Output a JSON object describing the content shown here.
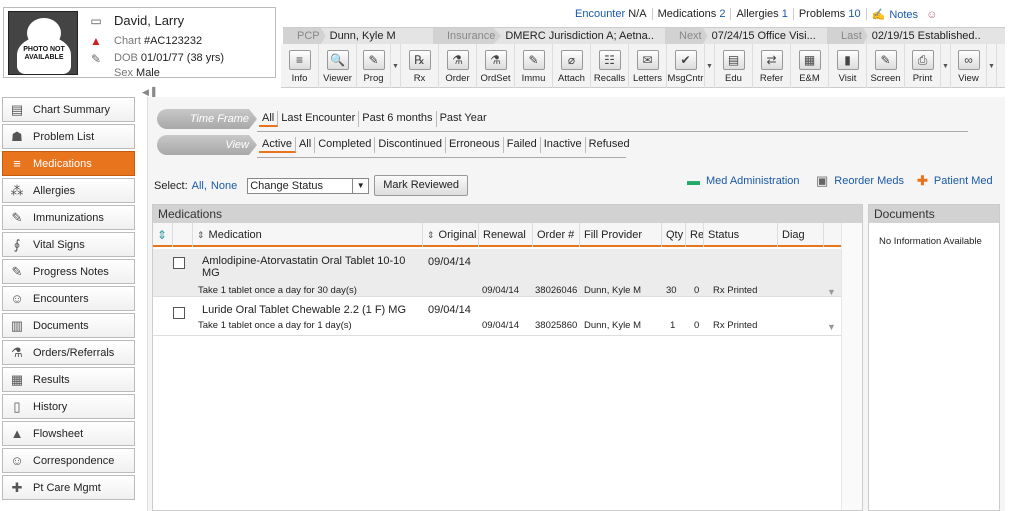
{
  "patient": {
    "photo_text": "PHOTO NOT AVAILABLE",
    "name": "David, Larry",
    "chart_label": "Chart",
    "chart_number": "#AC123232",
    "dob_label": "DOB",
    "dob_value": "01/01/77 (38 yrs)",
    "sex_label": "Sex",
    "sex_value": "Male"
  },
  "top_links": {
    "encounter_label": "Encounter",
    "encounter_value": "N/A",
    "medications_label": "Medications",
    "medications_count": "2",
    "allergies_label": "Allergies",
    "allergies_count": "1",
    "problems_label": "Problems",
    "problems_count": "10",
    "notes_label": "Notes"
  },
  "info_strip": [
    {
      "label": "PCP",
      "value": "Dunn, Kyle M"
    },
    {
      "label": "Insurance",
      "value": "DMERC Jurisdiction A; Aetna.."
    },
    {
      "label": "Next",
      "value": "07/24/15 Office Visi..."
    },
    {
      "label": "Last",
      "value": "02/19/15 Established.."
    }
  ],
  "toolbar": [
    {
      "label": "Info",
      "icon": "info-icon",
      "glyph": "≡"
    },
    {
      "label": "Viewer",
      "icon": "viewer-icon",
      "glyph": "🔍"
    },
    {
      "label": "Prog",
      "icon": "progress-icon",
      "glyph": "✎",
      "dropdown": true
    },
    {
      "label": "Rx",
      "icon": "rx-icon",
      "glyph": "℞"
    },
    {
      "label": "Order",
      "icon": "order-icon",
      "glyph": "⚗"
    },
    {
      "label": "OrdSet",
      "icon": "order-set-icon",
      "glyph": "⚗"
    },
    {
      "label": "Immu",
      "icon": "immunization-icon",
      "glyph": "✎"
    },
    {
      "label": "Attach",
      "icon": "attach-icon",
      "glyph": "⌀"
    },
    {
      "label": "Recalls",
      "icon": "recalls-icon",
      "glyph": "☷"
    },
    {
      "label": "Letters",
      "icon": "letters-icon",
      "glyph": "✉"
    },
    {
      "label": "MsgCntr",
      "icon": "message-center-icon",
      "glyph": "✔",
      "dropdown": true
    },
    {
      "label": "Edu",
      "icon": "education-icon",
      "glyph": "▤"
    },
    {
      "label": "Refer",
      "icon": "refer-icon",
      "glyph": "⇄"
    },
    {
      "label": "E&M",
      "icon": "em-icon",
      "glyph": "▦"
    },
    {
      "label": "Visit",
      "icon": "visit-icon",
      "glyph": "▮"
    },
    {
      "label": "Screen",
      "icon": "screen-icon",
      "glyph": "✎"
    },
    {
      "label": "Print",
      "icon": "print-icon",
      "glyph": "⎙",
      "dropdown": true
    },
    {
      "label": "View",
      "icon": "glasses-icon",
      "glyph": "∞",
      "dropdown": true
    }
  ],
  "sidebar": [
    {
      "label": "Chart Summary",
      "icon": "clipboard-icon",
      "glyph": "▤"
    },
    {
      "label": "Problem List",
      "icon": "doctor-icon",
      "glyph": "☗"
    },
    {
      "label": "Medications",
      "icon": "pills-icon",
      "glyph": "≡",
      "active": true
    },
    {
      "label": "Allergies",
      "icon": "allergies-icon",
      "glyph": "⁂"
    },
    {
      "label": "Immunizations",
      "icon": "syringe-icon",
      "glyph": "✎"
    },
    {
      "label": "Vital Signs",
      "icon": "stethoscope-icon",
      "glyph": "∮"
    },
    {
      "label": "Progress Notes",
      "icon": "notes-icon",
      "glyph": "✎"
    },
    {
      "label": "Encounters",
      "icon": "encounters-icon",
      "glyph": "☺"
    },
    {
      "label": "Documents",
      "icon": "documents-icon",
      "glyph": "▥"
    },
    {
      "label": "Orders/Referrals",
      "icon": "orders-icon",
      "glyph": "⚗"
    },
    {
      "label": "Results",
      "icon": "results-icon",
      "glyph": "▦"
    },
    {
      "label": "History",
      "icon": "history-icon",
      "glyph": "▯"
    },
    {
      "label": "Flowsheet",
      "icon": "flowsheet-icon",
      "glyph": "▲"
    },
    {
      "label": "Correspondence",
      "icon": "correspondence-icon",
      "glyph": "☺"
    },
    {
      "label": "Pt Care Mgmt",
      "icon": "care-management-icon",
      "glyph": "✚"
    }
  ],
  "filters": {
    "timeframe_label": "Time Frame",
    "timeframe_options": [
      "All",
      "Last Encounter",
      "Past 6 months",
      "Past Year"
    ],
    "timeframe_selected": 0,
    "view_label": "View",
    "view_options": [
      "Active",
      "All",
      "Completed",
      "Discontinued",
      "Erroneous",
      "Failed",
      "Inactive",
      "Refused"
    ],
    "view_selected": 0
  },
  "select_row": {
    "select_label": "Select:",
    "all": "All,",
    "none": "None",
    "status_dropdown": "Change Status",
    "mark_reviewed": "Mark Reviewed"
  },
  "actions": {
    "med_admin": "Med Administration",
    "reorder": "Reorder Meds",
    "patient_med": "Patient Med"
  },
  "medications_panel": {
    "title": "Medications",
    "columns": [
      "Medication",
      "Original",
      "Renewal",
      "Order #",
      "Fill Provider",
      "Qty",
      "Re",
      "Status",
      "Diag"
    ],
    "rows": [
      {
        "name": "Amlodipine-Atorvastatin Oral Tablet 10-10 MG",
        "original": "09/04/14",
        "sig": "Take 1 tablet once a day for 30 day(s)",
        "renewal": "09/04/14",
        "order": "38026046",
        "provider": "Dunn, Kyle M",
        "qty": "30",
        "re": "0",
        "status": "Rx Printed"
      },
      {
        "name": "Luride Oral Tablet Chewable 2.2 (1 F) MG",
        "original": "09/04/14",
        "sig": "Take 1 tablet once a day for 1 day(s)",
        "renewal": "09/04/14",
        "order": "38025860",
        "provider": "Dunn, Kyle M",
        "qty": "1",
        "re": "0",
        "status": "Rx Printed"
      }
    ]
  },
  "documents_panel": {
    "title": "Documents",
    "empty_text": "No Information Available"
  },
  "colors": {
    "accent": "#e8741e",
    "link": "#1a5aa8",
    "alert": "#cc2222"
  }
}
